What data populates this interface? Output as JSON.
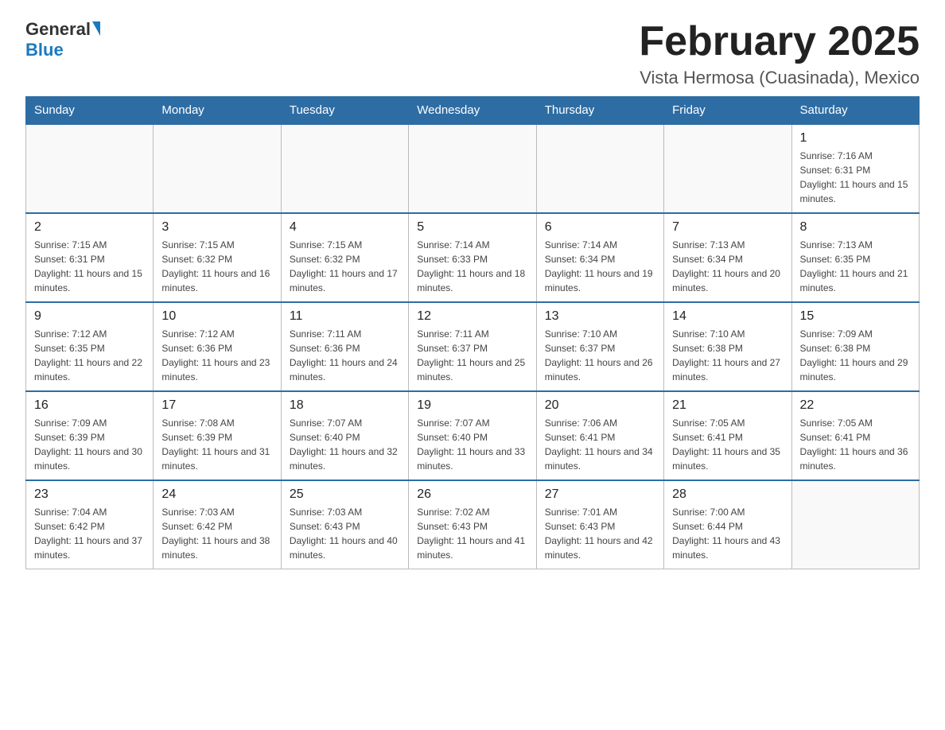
{
  "logo": {
    "general": "General",
    "blue": "Blue"
  },
  "title": "February 2025",
  "subtitle": "Vista Hermosa (Cuasinada), Mexico",
  "days_of_week": [
    "Sunday",
    "Monday",
    "Tuesday",
    "Wednesday",
    "Thursday",
    "Friday",
    "Saturday"
  ],
  "weeks": [
    [
      {
        "day": "",
        "info": ""
      },
      {
        "day": "",
        "info": ""
      },
      {
        "day": "",
        "info": ""
      },
      {
        "day": "",
        "info": ""
      },
      {
        "day": "",
        "info": ""
      },
      {
        "day": "",
        "info": ""
      },
      {
        "day": "1",
        "info": "Sunrise: 7:16 AM\nSunset: 6:31 PM\nDaylight: 11 hours and 15 minutes."
      }
    ],
    [
      {
        "day": "2",
        "info": "Sunrise: 7:15 AM\nSunset: 6:31 PM\nDaylight: 11 hours and 15 minutes."
      },
      {
        "day": "3",
        "info": "Sunrise: 7:15 AM\nSunset: 6:32 PM\nDaylight: 11 hours and 16 minutes."
      },
      {
        "day": "4",
        "info": "Sunrise: 7:15 AM\nSunset: 6:32 PM\nDaylight: 11 hours and 17 minutes."
      },
      {
        "day": "5",
        "info": "Sunrise: 7:14 AM\nSunset: 6:33 PM\nDaylight: 11 hours and 18 minutes."
      },
      {
        "day": "6",
        "info": "Sunrise: 7:14 AM\nSunset: 6:34 PM\nDaylight: 11 hours and 19 minutes."
      },
      {
        "day": "7",
        "info": "Sunrise: 7:13 AM\nSunset: 6:34 PM\nDaylight: 11 hours and 20 minutes."
      },
      {
        "day": "8",
        "info": "Sunrise: 7:13 AM\nSunset: 6:35 PM\nDaylight: 11 hours and 21 minutes."
      }
    ],
    [
      {
        "day": "9",
        "info": "Sunrise: 7:12 AM\nSunset: 6:35 PM\nDaylight: 11 hours and 22 minutes."
      },
      {
        "day": "10",
        "info": "Sunrise: 7:12 AM\nSunset: 6:36 PM\nDaylight: 11 hours and 23 minutes."
      },
      {
        "day": "11",
        "info": "Sunrise: 7:11 AM\nSunset: 6:36 PM\nDaylight: 11 hours and 24 minutes."
      },
      {
        "day": "12",
        "info": "Sunrise: 7:11 AM\nSunset: 6:37 PM\nDaylight: 11 hours and 25 minutes."
      },
      {
        "day": "13",
        "info": "Sunrise: 7:10 AM\nSunset: 6:37 PM\nDaylight: 11 hours and 26 minutes."
      },
      {
        "day": "14",
        "info": "Sunrise: 7:10 AM\nSunset: 6:38 PM\nDaylight: 11 hours and 27 minutes."
      },
      {
        "day": "15",
        "info": "Sunrise: 7:09 AM\nSunset: 6:38 PM\nDaylight: 11 hours and 29 minutes."
      }
    ],
    [
      {
        "day": "16",
        "info": "Sunrise: 7:09 AM\nSunset: 6:39 PM\nDaylight: 11 hours and 30 minutes."
      },
      {
        "day": "17",
        "info": "Sunrise: 7:08 AM\nSunset: 6:39 PM\nDaylight: 11 hours and 31 minutes."
      },
      {
        "day": "18",
        "info": "Sunrise: 7:07 AM\nSunset: 6:40 PM\nDaylight: 11 hours and 32 minutes."
      },
      {
        "day": "19",
        "info": "Sunrise: 7:07 AM\nSunset: 6:40 PM\nDaylight: 11 hours and 33 minutes."
      },
      {
        "day": "20",
        "info": "Sunrise: 7:06 AM\nSunset: 6:41 PM\nDaylight: 11 hours and 34 minutes."
      },
      {
        "day": "21",
        "info": "Sunrise: 7:05 AM\nSunset: 6:41 PM\nDaylight: 11 hours and 35 minutes."
      },
      {
        "day": "22",
        "info": "Sunrise: 7:05 AM\nSunset: 6:41 PM\nDaylight: 11 hours and 36 minutes."
      }
    ],
    [
      {
        "day": "23",
        "info": "Sunrise: 7:04 AM\nSunset: 6:42 PM\nDaylight: 11 hours and 37 minutes."
      },
      {
        "day": "24",
        "info": "Sunrise: 7:03 AM\nSunset: 6:42 PM\nDaylight: 11 hours and 38 minutes."
      },
      {
        "day": "25",
        "info": "Sunrise: 7:03 AM\nSunset: 6:43 PM\nDaylight: 11 hours and 40 minutes."
      },
      {
        "day": "26",
        "info": "Sunrise: 7:02 AM\nSunset: 6:43 PM\nDaylight: 11 hours and 41 minutes."
      },
      {
        "day": "27",
        "info": "Sunrise: 7:01 AM\nSunset: 6:43 PM\nDaylight: 11 hours and 42 minutes."
      },
      {
        "day": "28",
        "info": "Sunrise: 7:00 AM\nSunset: 6:44 PM\nDaylight: 11 hours and 43 minutes."
      },
      {
        "day": "",
        "info": ""
      }
    ]
  ]
}
